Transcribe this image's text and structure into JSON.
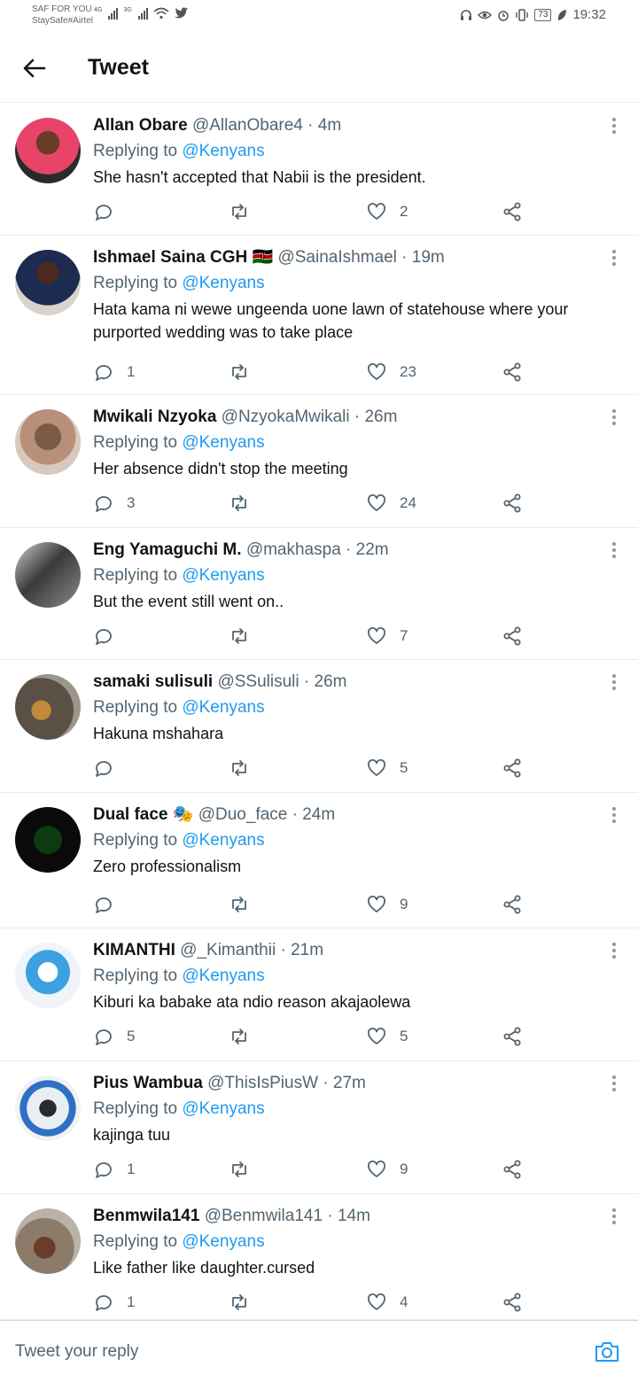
{
  "status_bar": {
    "carrier_line1": "SAF FOR YOU",
    "carrier_line2": "StaySafe#Airtel",
    "net1": "4G",
    "net2": "3G",
    "battery": "73",
    "time": "19:32"
  },
  "header": {
    "title": "Tweet"
  },
  "reply_prefix": "Replying to",
  "tweets": [
    {
      "name": "Allan Obare",
      "name_suffix": "",
      "handle": "@AllanObare4",
      "time": "4m",
      "replying_to": "@Kenyans",
      "text": "She hasn't accepted that Nabii is the president.",
      "replies": "",
      "retweets": "",
      "likes": "2"
    },
    {
      "name": "Ishmael Saina CGH",
      "name_suffix": "🇰🇪",
      "handle": "@SainaIshmael",
      "time": "19m",
      "replying_to": "@Kenyans",
      "text": "Hata kama ni wewe ungeenda uone lawn of statehouse where your purported wedding was to take place",
      "replies": "1",
      "retweets": "",
      "likes": "23"
    },
    {
      "name": "Mwikali Nzyoka",
      "name_suffix": "",
      "handle": "@NzyokaMwikali",
      "time": "26m",
      "replying_to": "@Kenyans",
      "text": "Her absence didn't stop the meeting",
      "replies": "3",
      "retweets": "",
      "likes": "24"
    },
    {
      "name": "Eng Yamaguchi M.",
      "name_suffix": "",
      "handle": "@makhaspa",
      "time": "22m",
      "replying_to": "@Kenyans",
      "text": "But the event still went on..",
      "replies": "",
      "retweets": "",
      "likes": "7"
    },
    {
      "name": "samaki sulisuli",
      "name_suffix": "",
      "handle": "@SSulisuli",
      "time": "26m",
      "replying_to": "@Kenyans",
      "text": "Hakuna mshahara",
      "replies": "",
      "retweets": "",
      "likes": "5"
    },
    {
      "name": "Dual face",
      "name_suffix": "🎭",
      "handle": "@Duo_face",
      "time": "24m",
      "replying_to": "@Kenyans",
      "text": "Zero professionalism",
      "replies": "",
      "retweets": "",
      "likes": "9"
    },
    {
      "name": "KIMANTHI",
      "name_suffix": "",
      "handle": "@_Kimanthii",
      "time": "21m",
      "replying_to": "@Kenyans",
      "text": "Kiburi ka babake ata ndio reason akajaolewa",
      "replies": "5",
      "retweets": "",
      "likes": "5"
    },
    {
      "name": "Pius Wambua",
      "name_suffix": "",
      "handle": "@ThisIsPiusW",
      "time": "27m",
      "replying_to": "@Kenyans",
      "text": "kajinga tuu",
      "replies": "1",
      "retweets": "",
      "likes": "9"
    },
    {
      "name": "Benmwila141",
      "name_suffix": "",
      "handle": "@Benmwila141",
      "time": "14m",
      "replying_to": "@Kenyans",
      "text": "Like father like daughter.cursed",
      "replies": "1",
      "retweets": "",
      "likes": "4"
    }
  ],
  "compose": {
    "placeholder": "Tweet your reply"
  },
  "colors": {
    "link": "#1d9bf0",
    "secondary": "#536471",
    "divider": "#e6ecf0"
  }
}
